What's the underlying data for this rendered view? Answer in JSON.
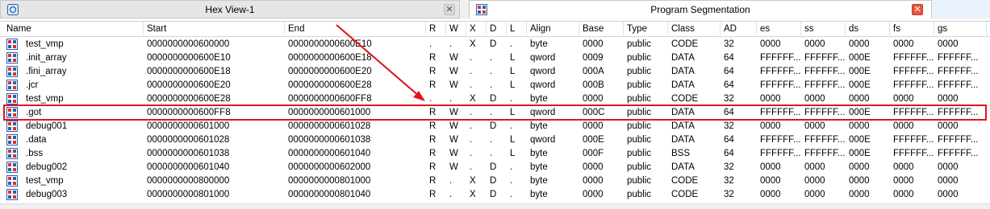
{
  "tabs": [
    {
      "title": "Hex View-1",
      "icon": "hex-view-icon",
      "close": "✕"
    },
    {
      "title": "Program Segmentation",
      "icon": "segments-icon",
      "close": "✕"
    }
  ],
  "columns": [
    "Name",
    "Start",
    "End",
    "R",
    "W",
    "X",
    "D",
    "L",
    "Align",
    "Base",
    "Type",
    "Class",
    "AD",
    "es",
    "ss",
    "ds",
    "fs",
    "gs"
  ],
  "rows": [
    [
      "test_vmp",
      "0000000000600000",
      "0000000000600E10",
      ".",
      ".",
      "X",
      "D",
      ".",
      "byte",
      "0000",
      "public",
      "CODE",
      "32",
      "0000",
      "0000",
      "0000",
      "0000",
      "0000"
    ],
    [
      ".init_array",
      "0000000000600E10",
      "0000000000600E18",
      "R",
      "W",
      ".",
      ".",
      "L",
      "qword",
      "0009",
      "public",
      "DATA",
      "64",
      "FFFFFF...",
      "FFFFFF...",
      "000E",
      "FFFFFF...",
      "FFFFFF..."
    ],
    [
      ".fini_array",
      "0000000000600E18",
      "0000000000600E20",
      "R",
      "W",
      ".",
      ".",
      "L",
      "qword",
      "000A",
      "public",
      "DATA",
      "64",
      "FFFFFF...",
      "FFFFFF...",
      "000E",
      "FFFFFF...",
      "FFFFFF..."
    ],
    [
      ".jcr",
      "0000000000600E20",
      "0000000000600E28",
      "R",
      "W",
      ".",
      ".",
      "L",
      "qword",
      "000B",
      "public",
      "DATA",
      "64",
      "FFFFFF...",
      "FFFFFF...",
      "000E",
      "FFFFFF...",
      "FFFFFF..."
    ],
    [
      "test_vmp",
      "0000000000600E28",
      "0000000000600FF8",
      ".",
      ".",
      "X",
      "D",
      ".",
      "byte",
      "0000",
      "public",
      "CODE",
      "32",
      "0000",
      "0000",
      "0000",
      "0000",
      "0000"
    ],
    [
      ".got",
      "0000000000600FF8",
      "0000000000601000",
      "R",
      "W",
      ".",
      ".",
      "L",
      "qword",
      "000C",
      "public",
      "DATA",
      "64",
      "FFFFFF...",
      "FFFFFF...",
      "000E",
      "FFFFFF...",
      "FFFFFF..."
    ],
    [
      "debug001",
      "0000000000601000",
      "0000000000601028",
      "R",
      "W",
      ".",
      "D",
      ".",
      "byte",
      "0000",
      "public",
      "DATA",
      "32",
      "0000",
      "0000",
      "0000",
      "0000",
      "0000"
    ],
    [
      ".data",
      "0000000000601028",
      "0000000000601038",
      "R",
      "W",
      ".",
      ".",
      "L",
      "qword",
      "000E",
      "public",
      "DATA",
      "64",
      "FFFFFF...",
      "FFFFFF...",
      "000E",
      "FFFFFF...",
      "FFFFFF..."
    ],
    [
      ".bss",
      "0000000000601038",
      "0000000000601040",
      "R",
      "W",
      ".",
      ".",
      "L",
      "byte",
      "000F",
      "public",
      "BSS",
      "64",
      "FFFFFF...",
      "FFFFFF...",
      "000E",
      "FFFFFF...",
      "FFFFFF..."
    ],
    [
      "debug002",
      "0000000000601040",
      "0000000000602000",
      "R",
      "W",
      ".",
      "D",
      ".",
      "byte",
      "0000",
      "public",
      "DATA",
      "32",
      "0000",
      "0000",
      "0000",
      "0000",
      "0000"
    ],
    [
      "test_vmp",
      "0000000000800000",
      "0000000000801000",
      "R",
      ".",
      "X",
      "D",
      ".",
      "byte",
      "0000",
      "public",
      "CODE",
      "32",
      "0000",
      "0000",
      "0000",
      "0000",
      "0000"
    ],
    [
      "debug003",
      "0000000000801000",
      "0000000000801040",
      "R",
      ".",
      "X",
      "D",
      ".",
      "byte",
      "0000",
      "public",
      "CODE",
      "32",
      "0000",
      "0000",
      "0000",
      "0000",
      "0000"
    ]
  ],
  "highlighted_row": 5,
  "colors": {
    "highlight": "#e0141e",
    "arrow": "#e0141e"
  },
  "row_icon": "segment-icon"
}
